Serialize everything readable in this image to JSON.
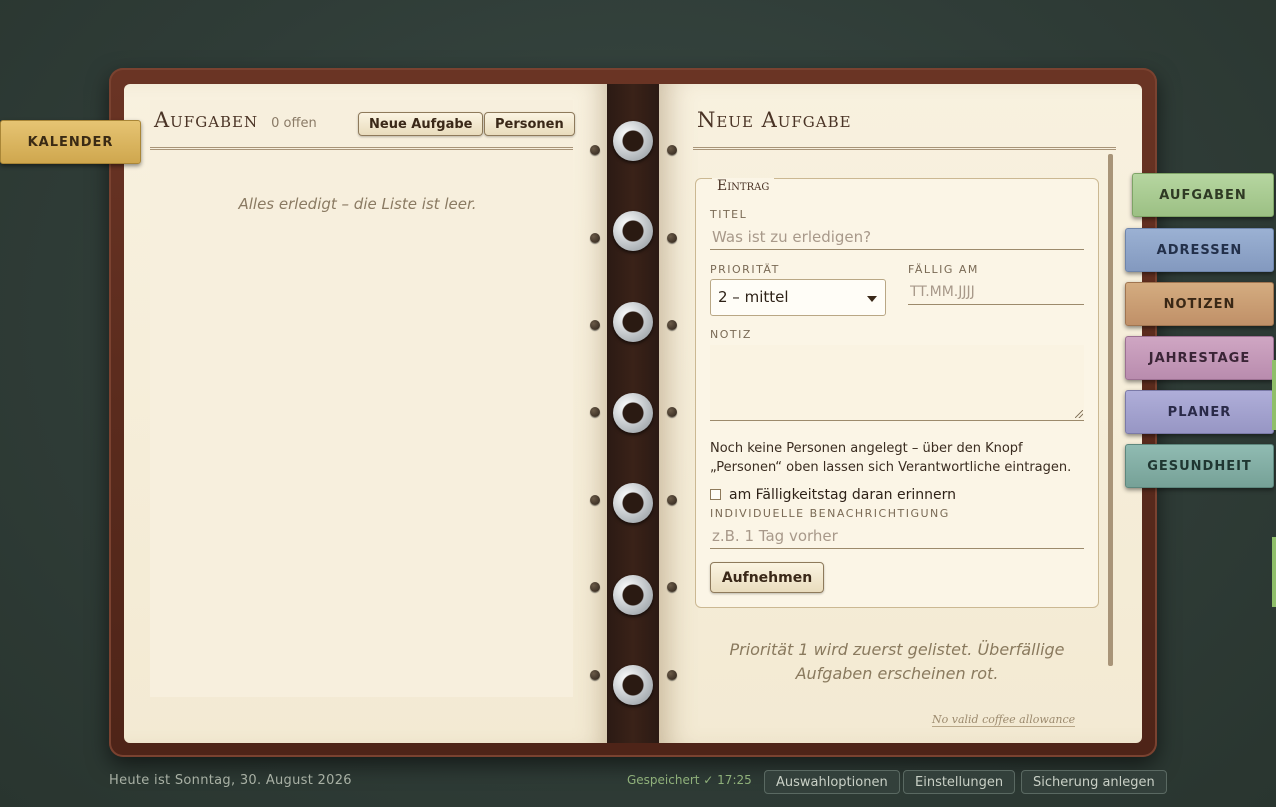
{
  "left_page": {
    "title": "Aufgaben",
    "open_count": "0 offen",
    "new_task_button": "Neue Aufgabe",
    "persons_button": "Personen",
    "empty_message": "Alles erledigt – die Liste ist leer."
  },
  "right_page": {
    "title": "Neue Aufgabe",
    "fieldset_legend": "Eintrag",
    "title_label": "TITEL",
    "title_placeholder": "Was ist zu erledigen?",
    "priority_label": "PRIORITÄT",
    "priority_value": "2 – mittel",
    "due_label": "FÄLLIG AM",
    "due_placeholder": "TT.MM.JJJJ",
    "note_label": "NOTIZ",
    "info_text": "Noch keine Personen angelegt – über den Knopf „Personen“ oben lassen sich Verantwortliche eintragen.",
    "remind_label": "am Fälligkeitstag daran erinnern",
    "notify_label": "INDIVIDUELLE BENACHRICHTIGUNG",
    "notify_placeholder": "z.B. 1 Tag vorher",
    "add_button": "Aufnehmen",
    "hint": "Priorität 1 wird zuerst gelistet. Überfällige Aufgaben erscheinen rot.",
    "coffee_link": "No valid coffee allowance"
  },
  "tabs": {
    "left": {
      "label": "KALENDER",
      "color": "#d9b75f"
    },
    "right": [
      {
        "label": "AUFGABEN",
        "color": "#a7c98f",
        "active": true
      },
      {
        "label": "ADRESSEN",
        "color": "#8ea4c9"
      },
      {
        "label": "NOTIZEN",
        "color": "#c99f74"
      },
      {
        "label": "JAHRESTAGE",
        "color": "#c49ab8"
      },
      {
        "label": "PLANER",
        "color": "#a3a2cf"
      },
      {
        "label": "GESUNDHEIT",
        "color": "#83afa6"
      }
    ]
  },
  "footer": {
    "today": "Heute ist Sonntag, 30. August 2026",
    "saved": "Gespeichert ✓ 17:25",
    "options_button": "Auswahloptionen",
    "settings_button": "Einstellungen",
    "backup_button": "Sicherung anlegen"
  }
}
